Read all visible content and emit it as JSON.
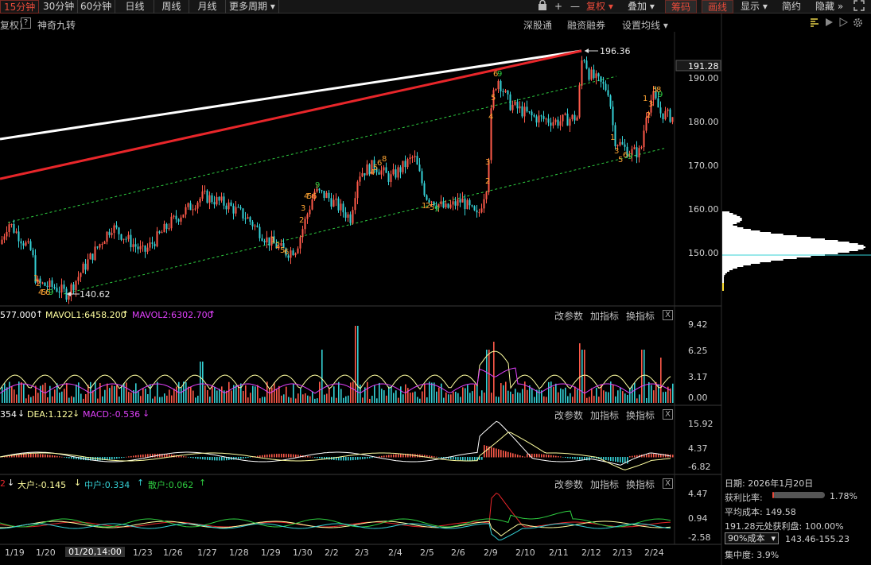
{
  "toolbar": {
    "periods": [
      "15分钟",
      "30分钟",
      "60分钟",
      "日线",
      "周线",
      "月线",
      "更多周期 ▾"
    ],
    "active_period": "15分钟",
    "lock_icon": "lock-icon",
    "plus": "+",
    "minus": "—",
    "fuquan": "复权",
    "diejia": "叠加",
    "choumai": "筹码",
    "huaxian": "画线",
    "xianshi": "显示",
    "jianyue": "简约",
    "yincang": "隐藏",
    "expand_icon": "expand-icon"
  },
  "header": {
    "fuquan_tag": "复权)",
    "help": "?",
    "indicator_name": "神奇九转",
    "links": [
      "深股通",
      "融资融券",
      "设置均线 ▾"
    ]
  },
  "price_axis": {
    "current": "191.28",
    "ticks": [
      "190.00",
      "180.00",
      "170.00",
      "160.00",
      "150.00"
    ]
  },
  "annotations": {
    "high": "196.36",
    "low": "140.62"
  },
  "volume_panel": {
    "legend": [
      "577.000",
      "MAVOL1:6458.200",
      "MAVOL2:6302.700"
    ],
    "buttons": [
      "改参数",
      "加指标",
      "换指标"
    ],
    "close": "X",
    "ticks": [
      "9.42",
      "6.25",
      "3.17",
      "0.00"
    ]
  },
  "macd_panel": {
    "legend": [
      "354",
      "DEA:1.122",
      "MACD:-0.536"
    ],
    "buttons": [
      "改参数",
      "加指标",
      "换指标"
    ],
    "close": "X",
    "ticks": [
      "15.92",
      "4.37",
      "-6.82"
    ]
  },
  "flow_panel": {
    "legend": [
      "2",
      "大户:-0.145",
      "中户:0.334",
      "散户:0.062"
    ],
    "buttons": [
      "改参数",
      "加指标",
      "换指标"
    ],
    "close": "X",
    "ticks": [
      "4.47",
      "0.94",
      "-2.58"
    ]
  },
  "date_axis": [
    "1/19",
    "1/20",
    "01/20,14:00",
    "1/23",
    "1/26",
    "1/27",
    "1/28",
    "1/29",
    "1/30",
    "2/2",
    "2/3",
    "2/4",
    "2/5",
    "2/6",
    "2/9",
    "2/10",
    "2/11",
    "2/12",
    "2/13",
    "2/24"
  ],
  "sidebar": {
    "date_label": "日期: 2026年1月20日",
    "profit_label": "获利比率:",
    "profit_value": "1.78%",
    "profit_fraction": 0.0178,
    "avg_cost_label": "平均成本: 149.58",
    "win_label": "191.28元处获利盘: 100.00%",
    "cost_select": "90%成本",
    "cost_range": "143.46-155.23",
    "concentration": "集中度: 3.9%"
  },
  "colors": {
    "up": "#ff5a4a",
    "down": "#35d1d6",
    "accent_red": "#e84a3a",
    "line_yellow": "#ffffa0",
    "line_magenta": "#e040fb",
    "green": "#2ecc40"
  }
}
